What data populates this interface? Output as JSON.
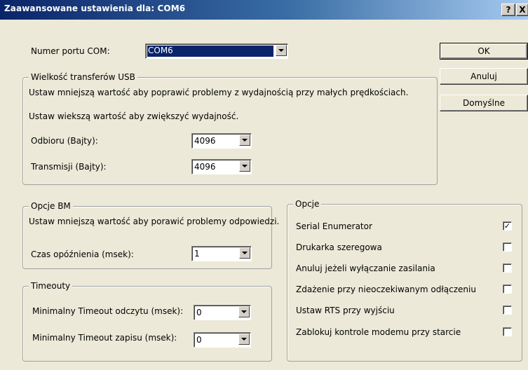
{
  "window": {
    "title": "Zaawansowane ustawienia dla: COM6",
    "help_label": "?",
    "close_label": "X"
  },
  "port": {
    "label": "Numer portu COM:",
    "value": "COM6"
  },
  "buttons": {
    "ok": "OK",
    "cancel": "Anuluj",
    "defaults": "Domyślne"
  },
  "usb": {
    "legend": "Wielkość transferów USB",
    "hint_small": "Ustaw mniejszą wartość aby poprawić problemy z wydajnością przy małych prędkościach.",
    "hint_large": "Ustaw wiekszą wartość aby zwiększyć wydajność.",
    "receive_label": "Odbioru (Bajty):",
    "receive_value": "4096",
    "transmit_label": "Transmisji (Bajty):",
    "transmit_value": "4096"
  },
  "bm": {
    "legend": "Opcje BM",
    "hint": "Ustaw mniejszą wartość aby porawić problemy odpowiedzi.",
    "latency_label": "Czas opóźnienia (msek):",
    "latency_value": "1"
  },
  "timeouts": {
    "legend": "Timeouty",
    "read_label": "Minimalny Timeout odczytu (msek):",
    "read_value": "0",
    "write_label": "Minimalny Timeout zapisu (msek):",
    "write_value": "0"
  },
  "options": {
    "legend": "Opcje",
    "items": [
      {
        "label": "Serial Enumerator",
        "checked": true,
        "mark": "✓"
      },
      {
        "label": "Drukarka szeregowa",
        "checked": false,
        "mark": ""
      },
      {
        "label": "Anuluj jeżeli wyłączanie zasilania",
        "checked": false,
        "mark": ""
      },
      {
        "label": "Zdażenie przy nieoczekiwanym odłączeniu",
        "checked": false,
        "mark": ""
      },
      {
        "label": "Ustaw RTS przy wyjściu",
        "checked": false,
        "mark": ""
      },
      {
        "label": "Zablokuj kontrole modemu przy starcie",
        "checked": false,
        "mark": ""
      }
    ]
  }
}
